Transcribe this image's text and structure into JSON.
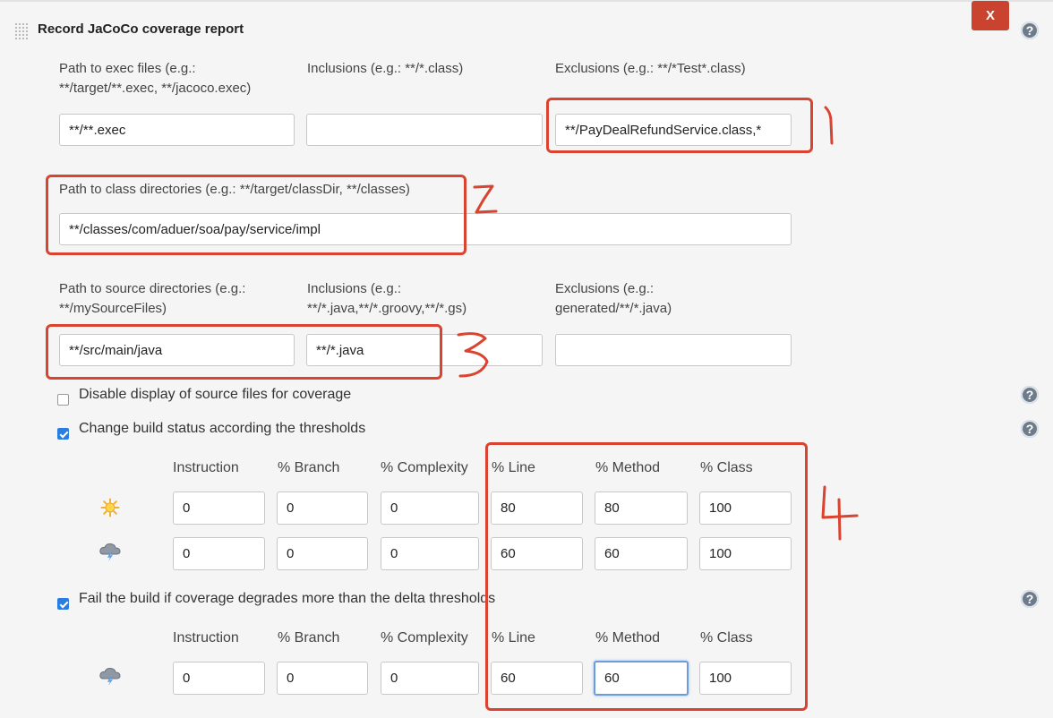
{
  "section": {
    "title": "Record JaCoCo coverage report",
    "close_label": "X"
  },
  "exec": {
    "path_label": "Path to exec files (e.g.: **/target/**.exec, **/jacoco.exec)",
    "path_label_line1": "Path to exec files (e.g.:",
    "path_label_line2": "**/target/**.exec, **/jacoco.exec)",
    "path_value": "**/**.exec",
    "inclusions_label": "Inclusions (e.g.: **/*.class)",
    "inclusions_value": "",
    "exclusions_label": "Exclusions (e.g.: **/*Test*.class)",
    "exclusions_value": "**/PayDealRefundService.class,*"
  },
  "classes": {
    "path_label": "Path to class directories (e.g.: **/target/classDir, **/classes)",
    "path_value": "**/classes/com/aduer/soa/pay/service/impl"
  },
  "sources": {
    "path_label_line1": "Path to source directories (e.g.:",
    "path_label_line2": "**/mySourceFiles)",
    "path_value": "**/src/main/java",
    "inclusions_label_line1": "Inclusions (e.g.:",
    "inclusions_label_line2": "**/*.java,**/*.groovy,**/*.gs)",
    "inclusions_value": "**/*.java",
    "exclusions_label_line1": "Exclusions (e.g.:",
    "exclusions_label_line2": "generated/**/*.java)",
    "exclusions_value": ""
  },
  "options": {
    "disable_source_display": {
      "label": "Disable display of source files for coverage",
      "checked": false
    },
    "change_build_status": {
      "label": "Change build status according the thresholds",
      "checked": true
    },
    "fail_on_delta": {
      "label": "Fail the build if coverage degrades more than the delta thresholds",
      "checked": true
    }
  },
  "threshold_headers": [
    "Instruction",
    "% Branch",
    "% Complexity",
    "% Line",
    "% Method",
    "% Class"
  ],
  "thresholds": {
    "sunny_icon": "sun-icon",
    "stormy_icon": "storm-cloud-icon",
    "sunny": [
      "0",
      "0",
      "0",
      "80",
      "80",
      "100"
    ],
    "stormy": [
      "0",
      "0",
      "0",
      "60",
      "60",
      "100"
    ]
  },
  "delta": {
    "headers": [
      "Instruction",
      "% Branch",
      "% Complexity",
      "% Line",
      "% Method",
      "% Class"
    ],
    "icon": "storm-cloud-icon",
    "values": [
      "0",
      "0",
      "0",
      "60",
      "60",
      "100"
    ]
  },
  "annotations": [
    "1",
    "2",
    "3",
    "4"
  ],
  "colors": {
    "annotation_red": "#d9432f",
    "checkbox_blue": "#2a7de1",
    "close_button": "#c9432e"
  }
}
